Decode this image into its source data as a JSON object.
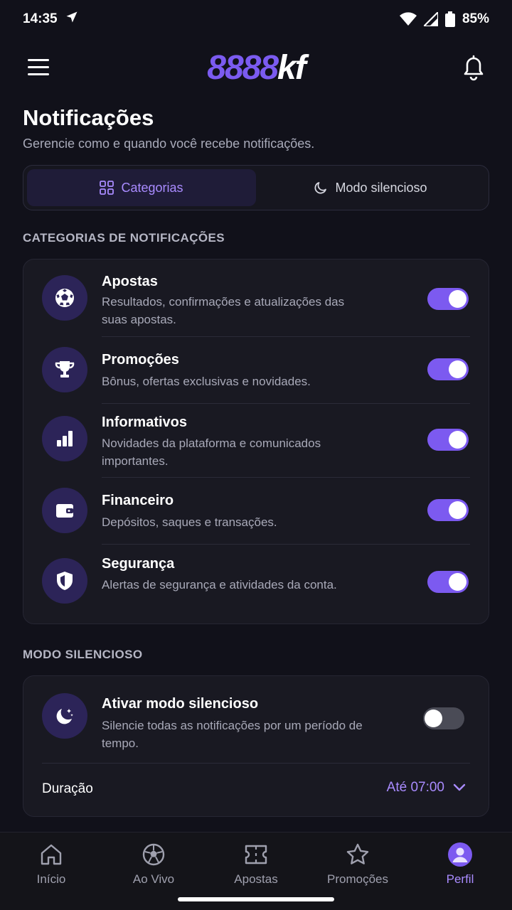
{
  "status_bar": {
    "time": "14:35",
    "battery": "85%"
  },
  "header": {
    "logo_number": "8888",
    "logo_text": "kf"
  },
  "page": {
    "title": "Notificações",
    "subtitle": "Gerencie como e quando você recebe notificações."
  },
  "tabs": [
    {
      "label": "Categorias",
      "icon": "grid-icon",
      "active": true
    },
    {
      "label": "Modo silencioso",
      "icon": "moon-icon",
      "active": false
    }
  ],
  "categories_section": {
    "label": "CATEGORIAS DE NOTIFICAÇÕES",
    "items": [
      {
        "title": "Apostas",
        "description": "Resultados, confirmações e atualizações das suas apostas.",
        "icon": "soccer-ball-icon",
        "enabled": true
      },
      {
        "title": "Promoções",
        "description": "Bônus, ofertas exclusivas e novidades.",
        "icon": "trophy-icon",
        "enabled": true
      },
      {
        "title": "Informativos",
        "description": "Novidades da plataforma e comunicados importantes.",
        "icon": "bar-chart-icon",
        "enabled": true
      },
      {
        "title": "Financeiro",
        "description": "Depósitos, saques e transações.",
        "icon": "wallet-icon",
        "enabled": true
      },
      {
        "title": "Segurança",
        "description": "Alertas de segurança e atividades da conta.",
        "icon": "shield-icon",
        "enabled": true
      }
    ]
  },
  "silent_section": {
    "label": "MODO SILENCIOSO",
    "toggle_title": "Ativar modo silencioso",
    "toggle_description": "Silencie todas as notificações por um período de tempo.",
    "enabled": false,
    "duration_label": "Duração",
    "duration_value": "Até 07:00"
  },
  "bottom_nav": [
    {
      "label": "Início",
      "icon": "home-icon",
      "active": false
    },
    {
      "label": "Ao Vivo",
      "icon": "soccer-ball-icon",
      "active": false
    },
    {
      "label": "Apostas",
      "icon": "ticket-icon",
      "active": false
    },
    {
      "label": "Promoções",
      "icon": "star-icon",
      "active": false
    },
    {
      "label": "Perfil",
      "icon": "profile-icon",
      "active": true
    }
  ],
  "colors": {
    "accent": "#7c5af0",
    "accent_text": "#a98bff",
    "background": "#11111a",
    "card": "#191922"
  }
}
